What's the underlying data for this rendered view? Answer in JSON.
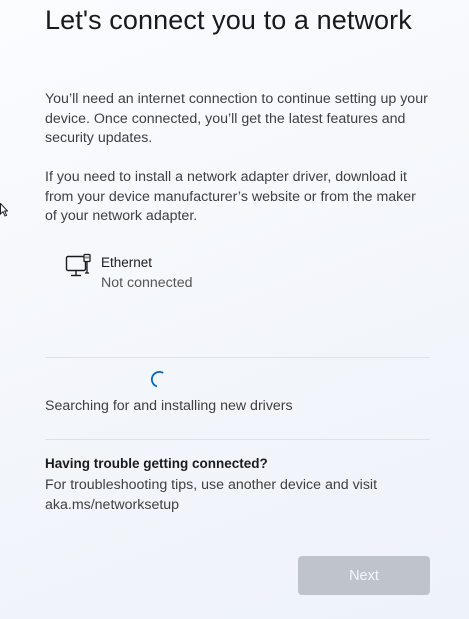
{
  "title": "Let's connect you to a network",
  "paragraphs": [
    "You’ll need an internet connection to continue setting up your device. Once connected, you’ll get the latest features and security updates.",
    "If you need to install a network adapter driver, download it from your device manufacturer’s website or from the maker of your network adapter."
  ],
  "network": {
    "icon": "ethernet-icon",
    "name": "Ethernet",
    "status": "Not connected"
  },
  "progress": {
    "icon": "spinner-icon",
    "text": "Searching for and installing new drivers"
  },
  "help": {
    "heading": "Having trouble getting connected?",
    "text": "For troubleshooting tips, use another device and visit aka.ms/networksetup"
  },
  "buttons": {
    "next_label": "Next",
    "next_enabled": false
  },
  "colors": {
    "accent": "#0067c0",
    "button_disabled_bg": "#bfc4cb",
    "button_disabled_text": "#f4f6f8"
  }
}
